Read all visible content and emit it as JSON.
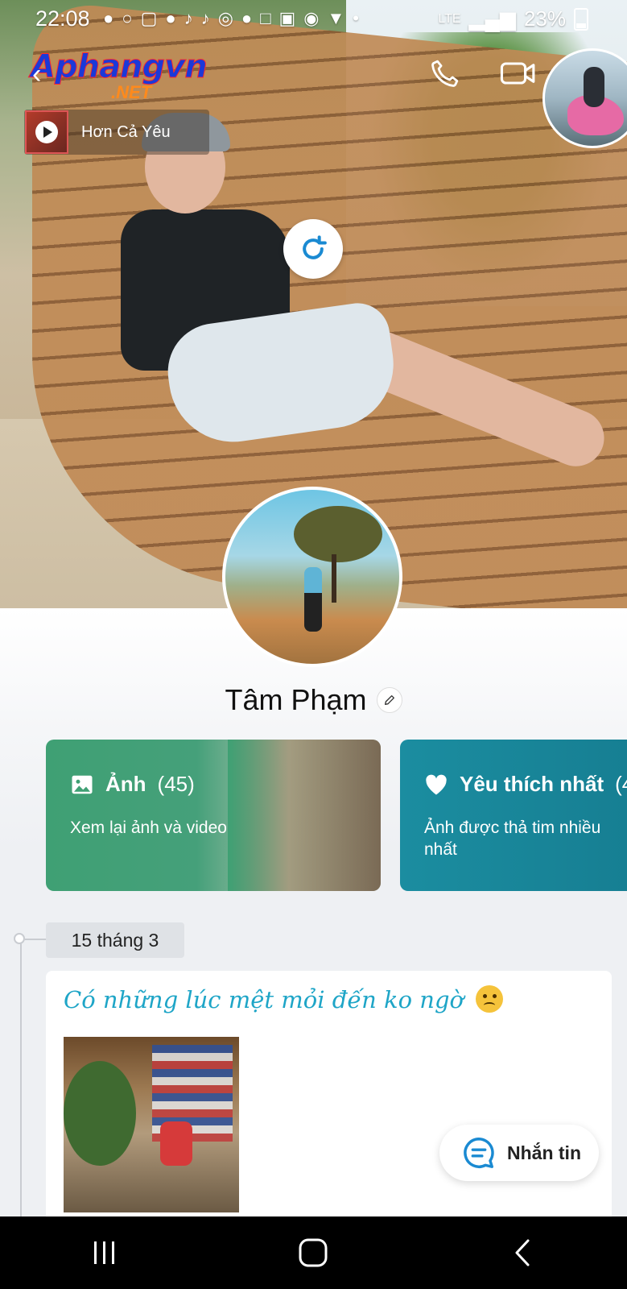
{
  "status_bar": {
    "time": "22:08",
    "notification_icons": [
      "person-add-icon",
      "facebook-icon",
      "instagram-icon",
      "facebook-icon",
      "tiktok-icon",
      "tiktok-icon",
      "hotspot-icon",
      "person-add-icon",
      "chat-icon",
      "zalo-icon",
      "messenger-icon",
      "location-icon",
      "dot-icon"
    ],
    "network": "LTE",
    "battery": "23%"
  },
  "watermark": {
    "brand": "Aphangvn",
    "suffix": ".NET"
  },
  "header": {
    "back_icon": "chevron-left-icon",
    "call_icon": "phone-icon",
    "video_icon": "video-camera-icon"
  },
  "music": {
    "title": "Hơn Cả Yêu",
    "play_icon": "play-icon"
  },
  "profile": {
    "name": "Tâm Phạm",
    "edit_icon": "pencil-icon"
  },
  "cards": [
    {
      "icon": "image-icon",
      "title": "Ảnh",
      "count": "(45)",
      "subtitle": "Xem lại ảnh và video",
      "color": "#3fa074"
    },
    {
      "icon": "heart-icon",
      "title": "Yêu thích nhất",
      "count": "(4",
      "subtitle": "Ảnh được thả tim nhiều nhất",
      "color": "#1b8da0"
    }
  ],
  "timeline": {
    "date": "15 tháng 3",
    "post_text": "Có những lúc mệt mỏi đến ko ngờ",
    "post_emoji": "confused-face-emoji"
  },
  "message_button": {
    "label": "Nhắn tin",
    "icon": "chat-bubble-icon"
  },
  "navbar": {
    "recent_icon": "recent-apps-icon",
    "home_icon": "home-icon",
    "back_icon": "back-icon"
  },
  "colors": {
    "accent": "#1ea5c7",
    "photos_card": "#3fa074",
    "fav_card": "#1b8da0",
    "message_icon": "#1a8ad2"
  }
}
